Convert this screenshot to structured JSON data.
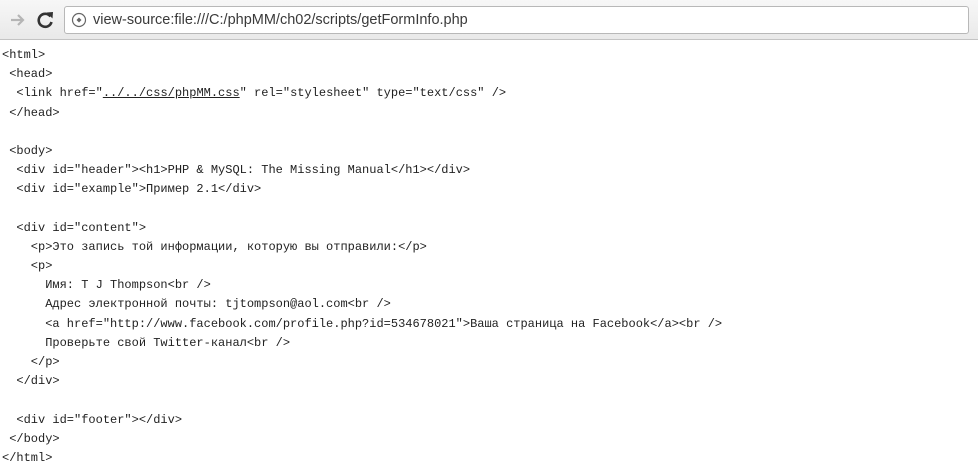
{
  "address_bar": {
    "url": "view-source:file:///C:/phpMM/ch02/scripts/getFormInfo.php"
  },
  "source_lines": [
    {
      "text": "<html>"
    },
    {
      "text": " <head>"
    },
    {
      "pre": "  <link href=\"",
      "link": "../../css/phpMM.css",
      "post": "\" rel=\"stylesheet\" type=\"text/css\" />"
    },
    {
      "text": " </head>"
    },
    {
      "text": ""
    },
    {
      "text": " <body>"
    },
    {
      "text": "  <div id=\"header\"><h1>PHP & MySQL: The Missing Manual</h1></div>"
    },
    {
      "text": "  <div id=\"example\">Пример 2.1</div>"
    },
    {
      "text": ""
    },
    {
      "text": "  <div id=\"content\">"
    },
    {
      "text": "    <p>Это запись той информации, которую вы отправили:</p>"
    },
    {
      "text": "    <p>"
    },
    {
      "text": "      Имя: T J Thompson<br />"
    },
    {
      "text": "      Адрес электронной почты: tjtompson@aol.com<br />"
    },
    {
      "text": "      <a href=\"http://www.facebook.com/profile.php?id=534678021\">Ваша страница на Facebook</a><br />"
    },
    {
      "text": "      Проверьте свой Twitter-канал<br />"
    },
    {
      "text": "    </p>"
    },
    {
      "text": "  </div>"
    },
    {
      "text": ""
    },
    {
      "text": "  <div id=\"footer\"></div>"
    },
    {
      "text": " </body>"
    },
    {
      "text": "</html>"
    }
  ]
}
